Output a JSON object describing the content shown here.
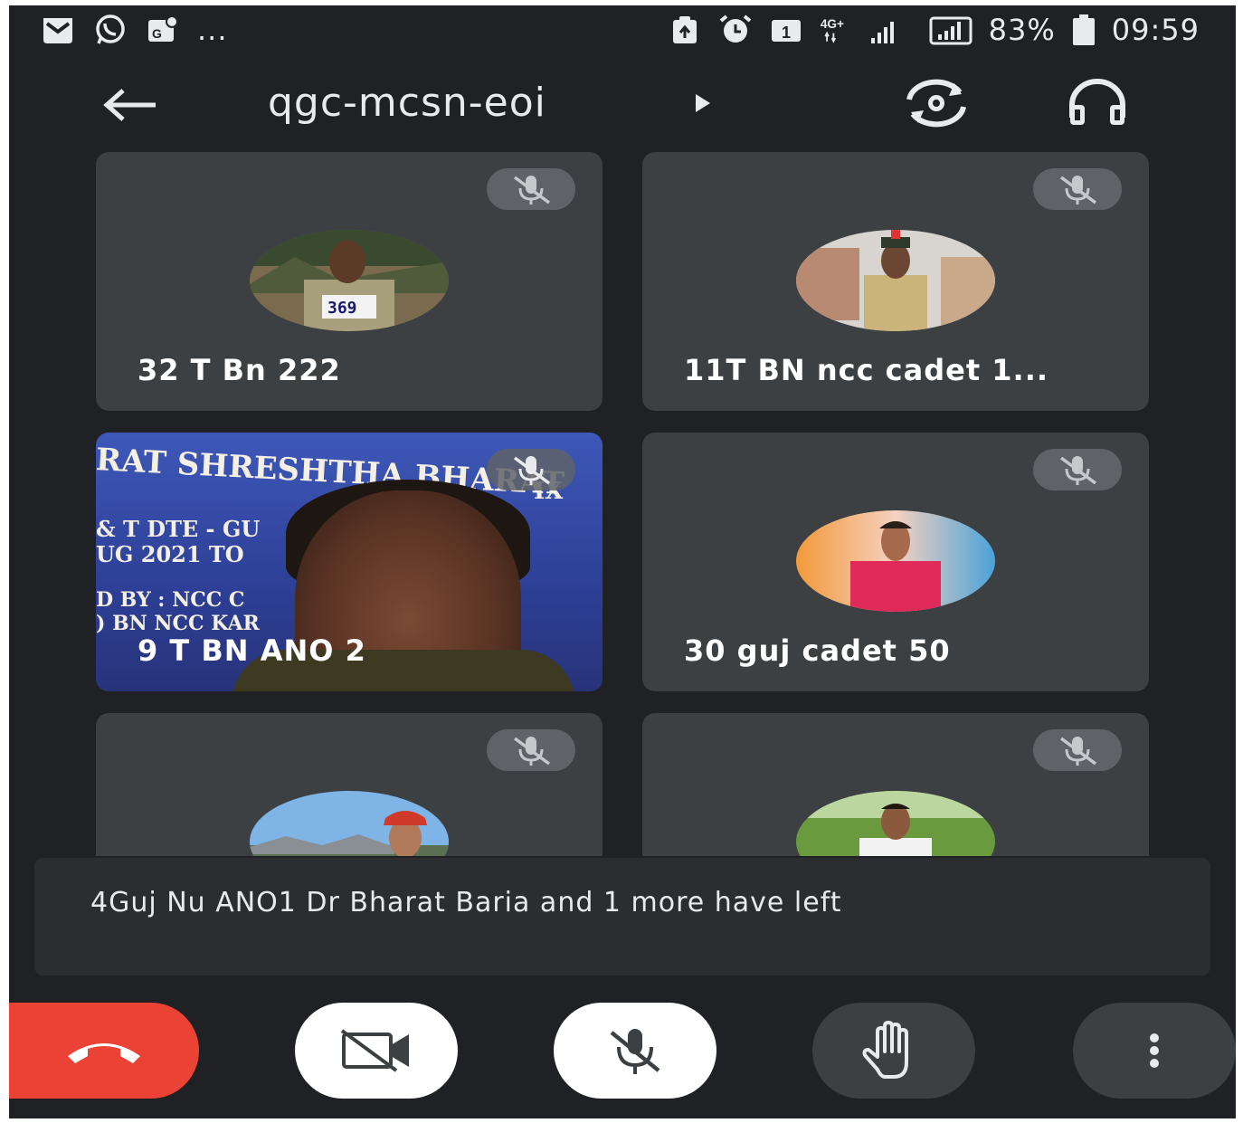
{
  "status_bar": {
    "left_icons": [
      "email-icon",
      "whatsapp-icon",
      "maps-icon"
    ],
    "overflow": "...",
    "network_label": "4G+",
    "battery_percent": "83%",
    "time": "09:59"
  },
  "meeting": {
    "code": "qgc-mcsn-eoi",
    "accent_end_call": "#ea4335"
  },
  "participants": [
    {
      "name": "32 T Bn 222",
      "muted": true,
      "has_video": false
    },
    {
      "name": "11T BN ncc cadet 1...",
      "muted": true,
      "has_video": false
    },
    {
      "name": "9 T BN ANO 2",
      "muted": true,
      "has_video": true
    },
    {
      "name": "30 guj cadet 50",
      "muted": true,
      "has_video": false
    },
    {
      "name": "",
      "muted": true,
      "has_video": false
    },
    {
      "name": "",
      "muted": true,
      "has_video": false
    }
  ],
  "video_banner": {
    "line1": "RAT SHRESHTHA BHARAT",
    "line1_suffix": "IX",
    "line2": "& T DTE - GU",
    "line3": "UG 2021 TO",
    "line4": "D BY : NCC C",
    "line5": ") BN NCC KAR"
  },
  "badge_369": "369",
  "notification": {
    "text": "4Guj Nu ANO1 Dr Bharat Baria and 1 more have left"
  },
  "controls": {
    "end_call": "end-call-icon",
    "camera": "camera-off-icon",
    "mic": "mic-off-icon",
    "raise_hand": "hand-icon",
    "more": "more-vert-icon"
  }
}
